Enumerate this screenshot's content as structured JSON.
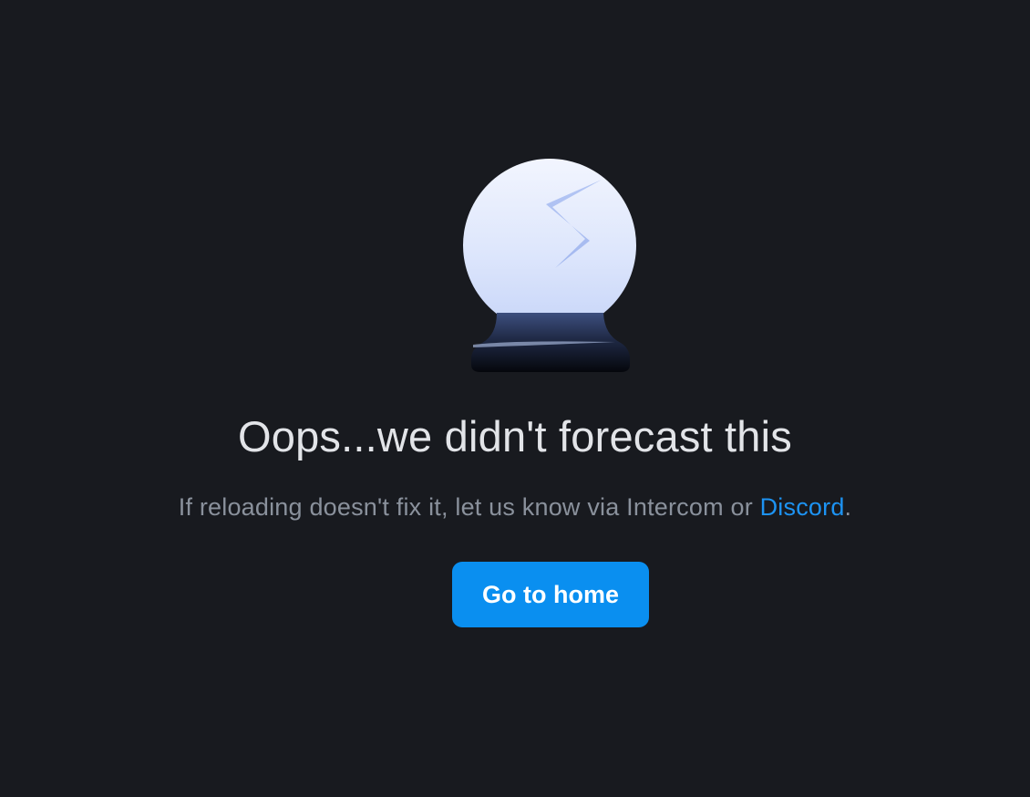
{
  "error": {
    "illustration_icon": "cracked-crystal-ball-icon",
    "headline": "Oops...we didn't forecast this",
    "message_prefix": "If reloading doesn't fix it, let us know via Intercom or ",
    "discord_link": "Discord",
    "message_suffix": ".",
    "home_button_label": "Go to home"
  },
  "colors": {
    "background": "#181a1f",
    "headline": "#e2e4e8",
    "muted_text": "#8a919c",
    "link": "#1d93f2",
    "button": "#0a8ff0",
    "button_text": "#ffffff"
  }
}
